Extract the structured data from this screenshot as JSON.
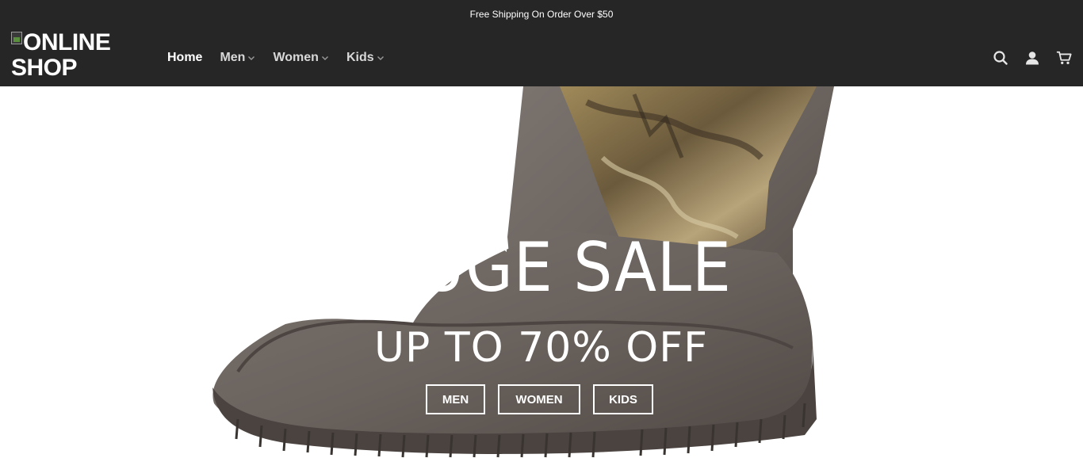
{
  "announcement": "Free Shipping On Order Over $50",
  "logo": {
    "line1": "ONLINE",
    "line2": "SHOP"
  },
  "nav": {
    "items": [
      {
        "label": "Home",
        "active": true,
        "dropdown": false
      },
      {
        "label": "Men",
        "active": false,
        "dropdown": true
      },
      {
        "label": "Women",
        "active": false,
        "dropdown": true
      },
      {
        "label": "Kids",
        "active": false,
        "dropdown": true
      }
    ]
  },
  "header_icons": [
    "search-icon",
    "account-icon",
    "cart-icon"
  ],
  "hero": {
    "title": "HUGE SALE",
    "subtitle": "UP TO 70% OFF",
    "buttons": [
      "MEN",
      "WOMEN",
      "KIDS"
    ]
  },
  "colors": {
    "header_bg": "#262626",
    "boot_rubber": "#6e6661",
    "text_light": "#ffffff"
  }
}
